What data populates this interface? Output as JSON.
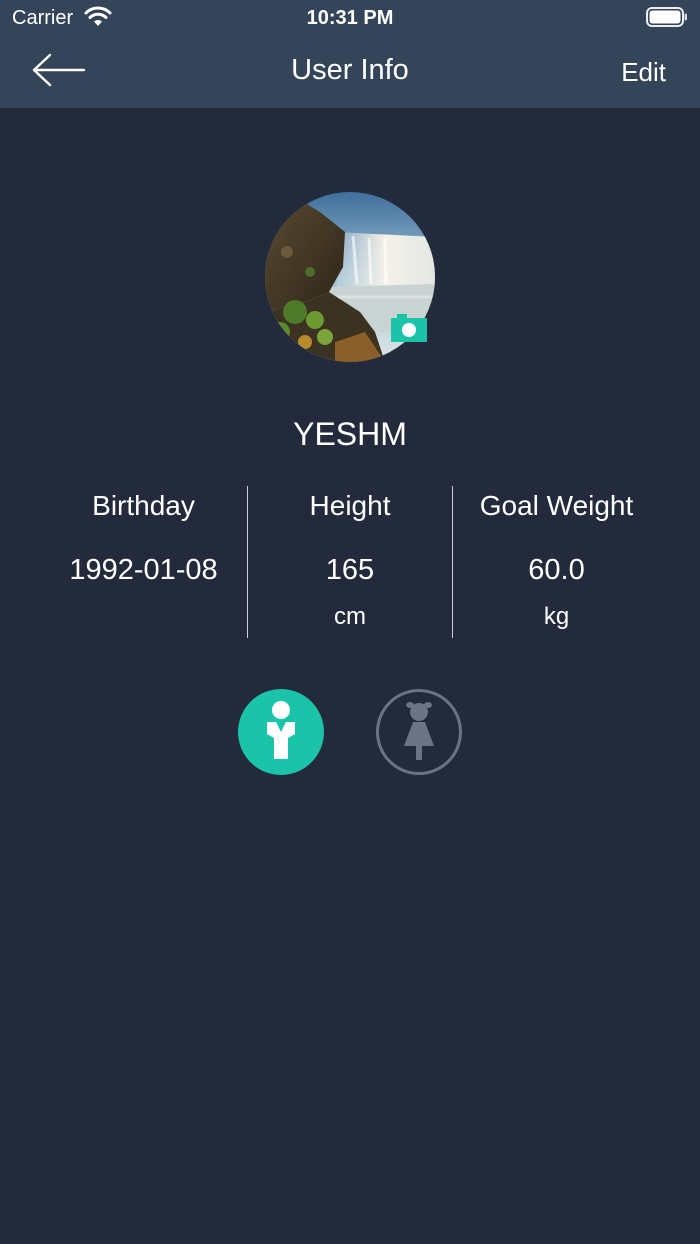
{
  "status_bar": {
    "carrier": "Carrier",
    "time": "10:31 PM"
  },
  "nav": {
    "title": "User Info",
    "edit_label": "Edit"
  },
  "profile": {
    "name": "YESHM"
  },
  "stats": [
    {
      "label": "Birthday",
      "value": "1992-01-08",
      "unit": ""
    },
    {
      "label": "Height",
      "value": "165",
      "unit": "cm"
    },
    {
      "label": "Goal Weight",
      "value": "60.0",
      "unit": "kg"
    }
  ],
  "gender": {
    "selected": "male"
  },
  "colors": {
    "background": "#222a3b",
    "nav_background": "#344459",
    "accent": "#1bc4a8",
    "inactive": "#6b7483"
  },
  "icons": {
    "back": "arrow-left-icon",
    "camera": "camera-icon",
    "male": "male-icon",
    "female": "female-icon",
    "wifi": "wifi-icon",
    "battery": "battery-icon"
  }
}
